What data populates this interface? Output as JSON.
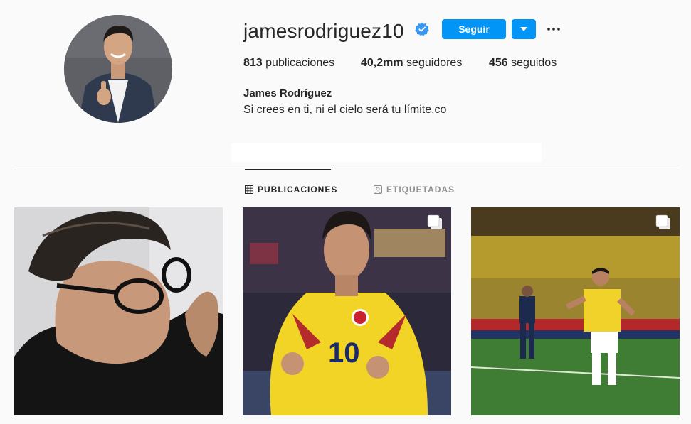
{
  "profile": {
    "username": "jamesrodriguez10",
    "verified": true,
    "follow_label": "Seguir",
    "full_name": "James Rodríguez",
    "bio": "Si crees en ti, ni el cielo será tu límite.co"
  },
  "stats": {
    "posts_count": "813",
    "posts_label": "publicaciones",
    "followers_count": "40,2mm",
    "followers_label": "seguidores",
    "following_count": "456",
    "following_label": "seguidos"
  },
  "tabs": [
    {
      "label": "PUBLICACIONES",
      "icon": "grid-icon",
      "active": true
    },
    {
      "label": "ETIQUETADAS",
      "icon": "tagged-icon",
      "active": false
    }
  ],
  "posts": [
    {
      "icon": "photo",
      "multi": false
    },
    {
      "icon": "carousel-icon",
      "multi": true
    },
    {
      "icon": "carousel-icon",
      "multi": true
    }
  ],
  "colors": {
    "accent": "#0095f6",
    "verified": "#3897f0",
    "text": "#262626",
    "muted": "#8e8e8e",
    "background": "#fafafa",
    "divider": "#dbdbdb"
  }
}
